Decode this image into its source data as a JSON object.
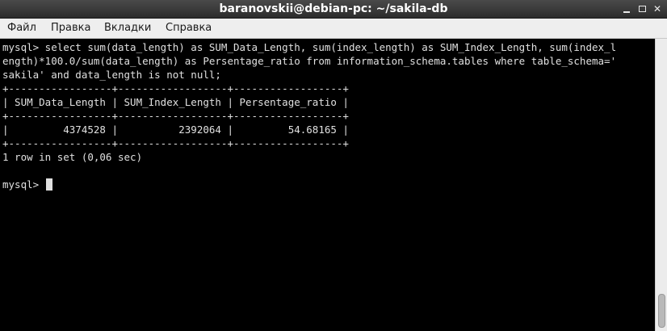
{
  "window": {
    "title": "baranovskii@debian-pc: ~/sakila-db"
  },
  "menu": {
    "file": "Файл",
    "edit": "Правка",
    "tabs": "Вкладки",
    "help": "Справка"
  },
  "terminal": {
    "lines": [
      "mysql> select sum(data_length) as SUM_Data_Length, sum(index_length) as SUM_Index_Length, sum(index_l",
      "ength)*100.0/sum(data_length) as Persentage_ratio from information_schema.tables where table_schema='",
      "sakila' and data_length is not null;",
      "+-----------------+------------------+------------------+",
      "| SUM_Data_Length | SUM_Index_Length | Persentage_ratio |",
      "+-----------------+------------------+------------------+",
      "|         4374528 |          2392064 |         54.68165 |",
      "+-----------------+------------------+------------------+",
      "1 row in set (0,06 sec)",
      "",
      "mysql> "
    ]
  },
  "colors": {
    "terminal_bg": "#000000",
    "terminal_fg": "#e0e0e0",
    "titlebar": "#3a3a3a",
    "menubar": "#eeeeee"
  }
}
